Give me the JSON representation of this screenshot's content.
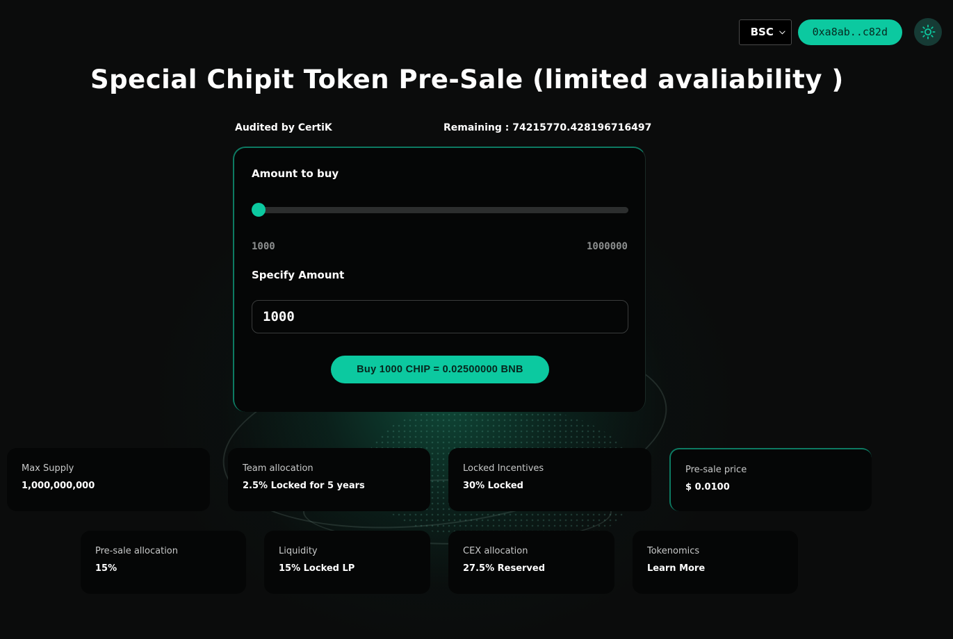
{
  "header": {
    "network": "BSC",
    "wallet": "0xa8ab..c82d",
    "theme_icon": "sun-icon"
  },
  "page": {
    "title": "Special Chipit Token Pre-Sale (limited avaliability )",
    "audited": "Audited by CertiK",
    "remaining": "Remaining : 74215770.428196716497"
  },
  "buy_card": {
    "amount_label": "Amount to buy",
    "slider_min": "1000",
    "slider_max": "1000000",
    "slider_level": 0,
    "specify_label": "Specify Amount",
    "amount_value": "1000",
    "buy_button": "Buy 1000 CHIP = 0.02500000 BNB"
  },
  "stats_row1": [
    {
      "label": "Max Supply",
      "value": "1,000,000,000"
    },
    {
      "label": "Team allocation",
      "value": "2.5% Locked for 5 years"
    },
    {
      "label": "Locked Incentives",
      "value": "30% Locked"
    },
    {
      "label": "Pre-sale price",
      "value": "$ 0.0100"
    }
  ],
  "stats_row2": [
    {
      "label": "Pre-sale allocation",
      "value": "15%"
    },
    {
      "label": "Liquidity",
      "value": "15% Locked LP"
    },
    {
      "label": "CEX allocation",
      "value": "27.5% Reserved"
    },
    {
      "label": "Tokenomics",
      "value": "Learn More"
    }
  ],
  "colors": {
    "accent": "#0cc9a0",
    "background": "#0b0c0c",
    "card": "#050606"
  }
}
